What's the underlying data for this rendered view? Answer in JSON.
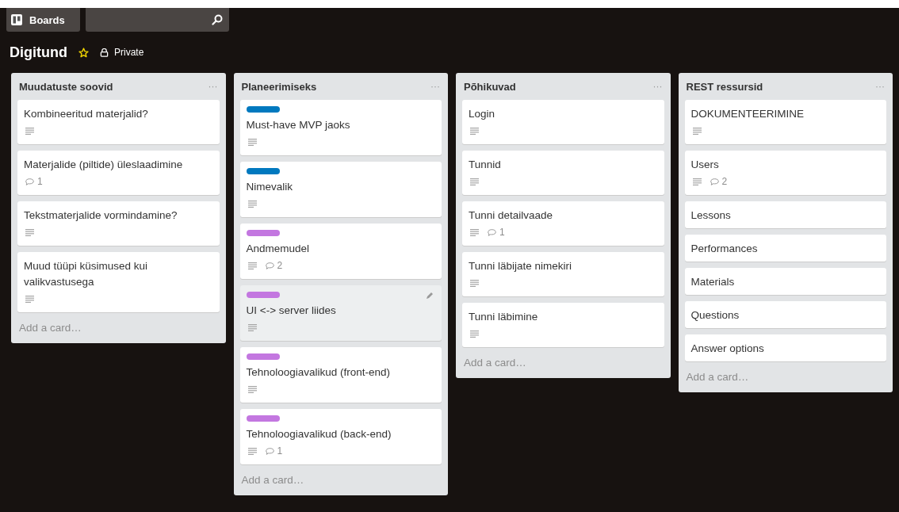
{
  "header": {
    "boards_button": "Boards"
  },
  "board": {
    "title": "Digitund",
    "starred": true,
    "visibility": "Private"
  },
  "lists": [
    {
      "title": "Muudatuste soovid",
      "menu": "···",
      "add_card": "Add a card…",
      "cards": [
        {
          "title": "Kombineeritud materjalid?",
          "description": true,
          "hovered": false
        },
        {
          "title": "Materjalide (piltide) üleslaadimine",
          "description": false,
          "comments": "1",
          "hovered": false
        },
        {
          "title": "Tekstmaterjalide vormindamine?",
          "description": true,
          "hovered": false
        },
        {
          "title": "Muud tüüpi küsimused kui valikvastusega",
          "description": true,
          "hovered": false
        }
      ]
    },
    {
      "title": "Planeerimiseks",
      "menu": "···",
      "add_card": "Add a card…",
      "cards": [
        {
          "title": "Must-have MVP jaoks",
          "labels": [
            {
              "color": "#0079bf"
            }
          ],
          "description": true,
          "hovered": false
        },
        {
          "title": "Nimevalik",
          "labels": [
            {
              "color": "#0079bf"
            }
          ],
          "description": true,
          "hovered": false
        },
        {
          "title": "Andmemudel",
          "labels": [
            {
              "color": "#c377e0"
            }
          ],
          "description": true,
          "comments": "2",
          "hovered": false
        },
        {
          "title": "UI <-> server liides",
          "labels": [
            {
              "color": "#c377e0"
            }
          ],
          "description": true,
          "hovered": true
        },
        {
          "title": "Tehnoloogiavalikud (front-end)",
          "labels": [
            {
              "color": "#c377e0"
            }
          ],
          "description": true,
          "hovered": false
        },
        {
          "title": "Tehnoloogiavalikud (back-end)",
          "labels": [
            {
              "color": "#c377e0"
            }
          ],
          "description": true,
          "comments": "1",
          "hovered": false
        }
      ]
    },
    {
      "title": "Põhikuvad",
      "menu": "···",
      "add_card": "Add a card…",
      "cards": [
        {
          "title": "Login",
          "description": true,
          "hovered": false
        },
        {
          "title": "Tunnid",
          "description": true,
          "hovered": false
        },
        {
          "title": "Tunni detailvaade",
          "description": true,
          "comments": "1",
          "hovered": false
        },
        {
          "title": "Tunni läbijate nimekiri",
          "description": true,
          "hovered": false
        },
        {
          "title": "Tunni läbimine",
          "description": true,
          "hovered": false
        }
      ]
    },
    {
      "title": "REST ressursid",
      "menu": "···",
      "add_card": "Add a card…",
      "cards": [
        {
          "title": "DOKUMENTEERIMINE",
          "description": true,
          "hovered": false
        },
        {
          "title": "Users",
          "description": true,
          "comments": "2",
          "hovered": false
        },
        {
          "title": "Lessons",
          "description": false,
          "hovered": false
        },
        {
          "title": "Performances",
          "description": false,
          "hovered": false
        },
        {
          "title": "Materials",
          "description": false,
          "hovered": false
        },
        {
          "title": "Questions",
          "description": false,
          "hovered": false
        },
        {
          "title": "Answer options",
          "description": false,
          "hovered": false
        }
      ]
    }
  ]
}
